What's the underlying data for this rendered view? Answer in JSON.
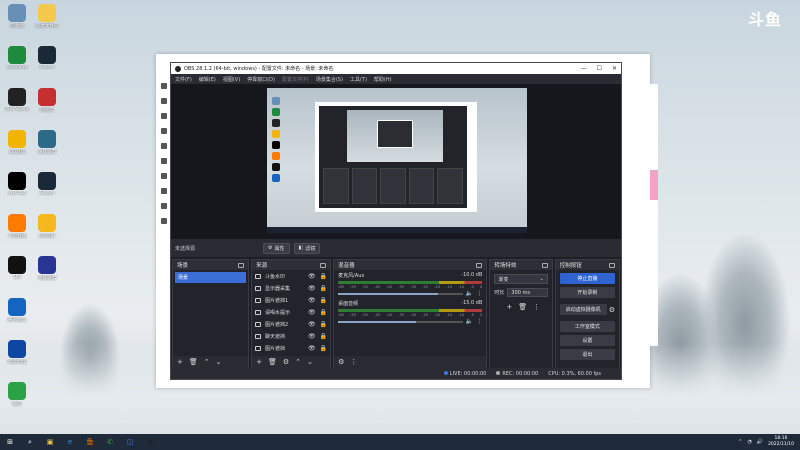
{
  "desktop": {
    "watermark": "斗鱼",
    "icons_left": [
      {
        "label": "回收站",
        "icon": "recycle-bin-icon",
        "color": "#6a8fb7"
      },
      {
        "label": "WeGame",
        "icon": "wegame-icon",
        "color": "#1d8a3e"
      },
      {
        "label": "OBS Studio",
        "icon": "obs-icon",
        "color": "#222222"
      },
      {
        "label": "QQ游戏",
        "icon": "qq-games-icon",
        "color": "#f1b500"
      },
      {
        "label": "WeChat",
        "icon": "wechat-icon",
        "color": "#000000"
      },
      {
        "label": "斗鱼直播",
        "icon": "douyu-icon",
        "color": "#ff7a00"
      },
      {
        "label": "QQ",
        "icon": "qq-icon",
        "color": "#111111"
      },
      {
        "label": "腾讯会议",
        "icon": "meeting-icon",
        "color": "#1565c0"
      },
      {
        "label": "哔哩哔哩",
        "icon": "app-icon",
        "color": "#0d47a1"
      },
      {
        "label": "微信",
        "icon": "wechat-green-icon",
        "color": "#2ba245"
      }
    ],
    "icons_right": [
      {
        "label": "新建文件夹",
        "icon": "folder-icon",
        "color": "#f2c94c"
      },
      {
        "label": "Steam",
        "icon": "steam-icon",
        "color": "#1b2838"
      },
      {
        "label": "网易云",
        "icon": "netease-icon",
        "color": "#c62f2f"
      },
      {
        "label": "英雄联盟",
        "icon": "lol-icon",
        "color": "#2d6a8a"
      },
      {
        "label": "Steam",
        "icon": "steam-icon",
        "color": "#1b2838"
      },
      {
        "label": "QQ音乐",
        "icon": "qqmusic-icon",
        "color": "#f5b81f"
      },
      {
        "label": "英雄联盟",
        "icon": "lol-icon",
        "color": "#283593"
      }
    ]
  },
  "obs": {
    "title": "OBS 28.1.2 (64-bit, windows) - 配置文件: 未命名 - 场景: 未命名",
    "window_controls": [
      "—",
      "☐",
      "✕"
    ],
    "menu": [
      "文件(F)",
      "编辑(E)",
      "视图(V)",
      "停靠窗口(D)",
      "配置文件(P)",
      "场景集合(S)",
      "工具(T)",
      "帮助(H)"
    ],
    "toolbar": {
      "no_source": "未选择源",
      "properties": "属性",
      "filters": "滤镜"
    },
    "docks": {
      "scenes": {
        "title": "场景",
        "items": [
          "场景"
        ]
      },
      "sources": {
        "title": "来源",
        "items": [
          "斗鱼水印",
          "显示器采集",
          "图片遮挡1",
          "请喝水提示",
          "图片遮挡2",
          "聊天遮挡",
          "图片遮挡"
        ]
      },
      "mixer": {
        "title": "混音器",
        "channels": [
          {
            "name": "麦克风/Aux",
            "db": "-10.0 dB",
            "fader": 0.8
          },
          {
            "name": "桌面音频",
            "db": "-15.0 dB",
            "fader": 0.62
          }
        ],
        "scale": [
          "-60",
          "-55",
          "-50",
          "-45",
          "-40",
          "-35",
          "-30",
          "-25",
          "-20",
          "-15",
          "-10",
          "-5",
          "0"
        ]
      },
      "transitions": {
        "title": "转场特效",
        "type": "渐变",
        "duration_label": "时长",
        "duration": "300 ms"
      },
      "controls": {
        "title": "控制按钮",
        "buttons": [
          "停止直播",
          "开始录制",
          "启动虚拟摄像机",
          "工作室模式",
          "设置",
          "退出"
        ]
      }
    },
    "status": {
      "live": "LIVE: 00:00:00",
      "rec": "REC: 00:00:00",
      "cpu": "CPU: 0.3%, 60.00 fps"
    }
  },
  "taskbar": {
    "apps": [
      "start-icon",
      "search-icon",
      "explorer-icon",
      "edge-icon",
      "douyu-icon",
      "wechat-icon",
      "store-icon",
      "obs-icon"
    ],
    "time": "18:16",
    "date": "2022/11/10"
  }
}
